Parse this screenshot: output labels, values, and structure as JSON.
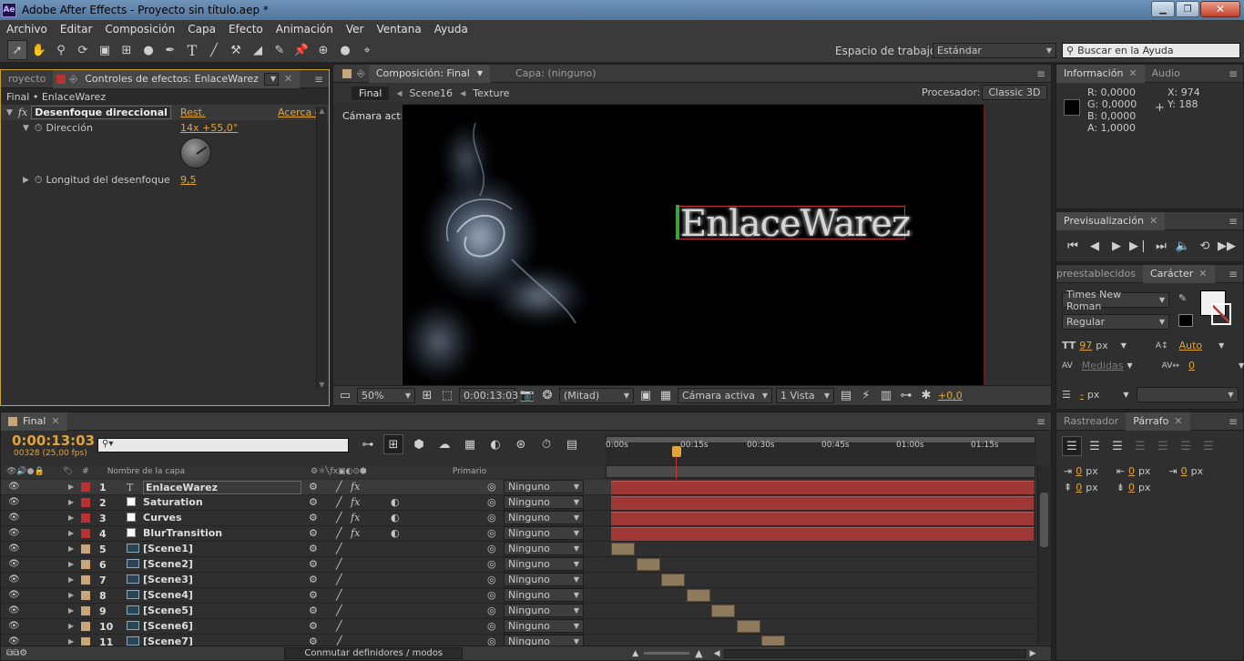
{
  "titlebar": {
    "title": "Adobe After Effects - Proyecto sin título.aep *",
    "logo": "Ae"
  },
  "menubar": [
    "Archivo",
    "Editar",
    "Composición",
    "Capa",
    "Efecto",
    "Animación",
    "Ver",
    "Ventana",
    "Ayuda"
  ],
  "toolbar": {
    "workspace_label": "Espacio de trabajo:",
    "workspace_value": "Estándar",
    "help_placeholder": "Buscar en la Ayuda"
  },
  "left_panel": {
    "tab_project": "royecto",
    "tab_effects": "Controles de efectos: EnlaceWarez",
    "breadcrumb": "Final • EnlaceWarez",
    "effect_name": "Desenfoque direccional",
    "reset_label": "Rest.",
    "about_label": "Acerca d",
    "prop1_name": "Dirección",
    "prop1_value": "14x +55,0°",
    "prop2_name": "Longitud del desenfoque",
    "prop2_value": "9,5",
    "fx_label": "fx"
  },
  "comp_panel": {
    "tab_comp": "Composición: Final",
    "tab_layer": "Capa: (ninguno)",
    "crumbs": [
      "Final",
      "Scene16",
      "Texture"
    ],
    "renderer_label": "Procesador:",
    "renderer_value": "Classic 3D",
    "camera_label": "Cámara activa",
    "title_text": "EnlaceWarez",
    "footer": {
      "zoom": "50%",
      "timecode": "0:00:13:03",
      "resolution": "(Mitad)",
      "camera": "Cámara activa",
      "views": "1 Vista",
      "exposure": "+0,0"
    }
  },
  "info_panel": {
    "tab_info": "Información",
    "tab_audio": "Audio",
    "r": "R:  0,0000",
    "g": "G:  0,0000",
    "b": "B:  0,0000",
    "a": "A:  1,0000",
    "x": "X:  974",
    "y": "Y:  188",
    "color": "#000000"
  },
  "preview_panel": {
    "tab": "Previsualización"
  },
  "char_panel": {
    "tab_presets": "preestablecidos",
    "tab_char": "Carácter",
    "font": "Times New Roman",
    "style": "Regular",
    "size": "97",
    "size_unit": "px",
    "leading": "Auto",
    "kerning": "Medidas",
    "tracking": "0",
    "stroke_width": "-",
    "stroke_unit": "px"
  },
  "paragraph_panel": {
    "tab_tracker": "Rastreador",
    "tab_para": "Párrafo",
    "indent_values": [
      "0",
      "0",
      "0",
      "0",
      "0"
    ],
    "unit": "px"
  },
  "timeline": {
    "tab": "Final",
    "timecode": "0:00:13:03",
    "frame_info": "00328 (25,00 fps)",
    "search_placeholder": "",
    "col_num": "#",
    "col_name": "Nombre de la capa",
    "col_parent": "Primario",
    "ruler": [
      "0:00s",
      "00:15s",
      "00:30s",
      "00:45s",
      "01:00s",
      "01:15s"
    ],
    "toggle_label": "Conmutar definidores / modos",
    "layers": [
      {
        "num": "1",
        "name": "EnlaceWarez",
        "type": "text",
        "color": "#b83232",
        "parent": "Ninguno"
      },
      {
        "num": "2",
        "name": "Saturation",
        "type": "solid",
        "color": "#b83232",
        "parent": "Ninguno"
      },
      {
        "num": "3",
        "name": "Curves",
        "type": "solid",
        "color": "#b83232",
        "parent": "Ninguno"
      },
      {
        "num": "4",
        "name": "BlurTransition",
        "type": "solid",
        "color": "#b83232",
        "parent": "Ninguno"
      },
      {
        "num": "5",
        "name": "[Scene1]",
        "type": "comp",
        "color": "#c9a57a",
        "parent": "Ninguno"
      },
      {
        "num": "6",
        "name": "[Scene2]",
        "type": "comp",
        "color": "#c9a57a",
        "parent": "Ninguno"
      },
      {
        "num": "7",
        "name": "[Scene3]",
        "type": "comp",
        "color": "#c9a57a",
        "parent": "Ninguno"
      },
      {
        "num": "8",
        "name": "[Scene4]",
        "type": "comp",
        "color": "#c9a57a",
        "parent": "Ninguno"
      },
      {
        "num": "9",
        "name": "[Scene5]",
        "type": "comp",
        "color": "#c9a57a",
        "parent": "Ninguno"
      },
      {
        "num": "10",
        "name": "[Scene6]",
        "type": "comp",
        "color": "#c9a57a",
        "parent": "Ninguno"
      },
      {
        "num": "11",
        "name": "[Scene7]",
        "type": "comp",
        "color": "#c9a57a",
        "parent": "Ninguno"
      }
    ]
  }
}
